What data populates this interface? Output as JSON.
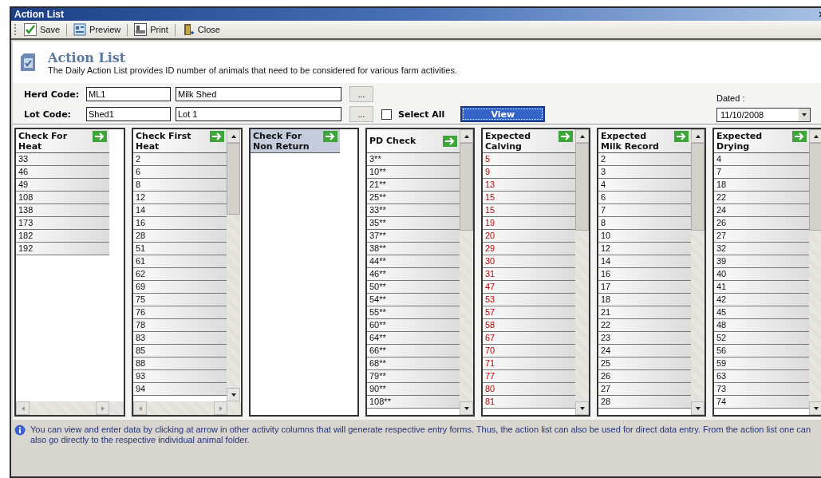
{
  "window": {
    "title": "Action List"
  },
  "toolbar": [
    {
      "kind": "save",
      "label": "Save"
    },
    {
      "kind": "preview",
      "label": "Preview"
    },
    {
      "kind": "print",
      "label": "Print"
    },
    {
      "kind": "close",
      "label": "Close"
    }
  ],
  "header": {
    "title": "Action List",
    "description": "The Daily Action List provides ID number of animals that need to be considered for various farm activities."
  },
  "form": {
    "herd": {
      "label": "Herd Code:",
      "code": "ML1",
      "name": "Milk Shed",
      "browse": "..."
    },
    "lot": {
      "label": "Lot Code:",
      "code": "Shed1",
      "name": "Lot 1",
      "browse": "..."
    },
    "select_all": {
      "label": "Select All",
      "checked": false
    },
    "view_button": "View",
    "dated": {
      "label": "Dated :",
      "value": "11/10/2008"
    }
  },
  "columns": [
    {
      "title": "Check For Heat",
      "selected": false,
      "kind": "plain",
      "vscroll": false,
      "hscroll": true,
      "rows": [
        "33",
        "46",
        "49",
        "108",
        "138",
        "173",
        "182",
        "192"
      ]
    },
    {
      "title": "Check First Heat",
      "selected": false,
      "kind": "plain",
      "vscroll": true,
      "hscroll": true,
      "rows": [
        "2",
        "6",
        "8",
        "12",
        "14",
        "16",
        "28",
        "51",
        "61",
        "62",
        "69",
        "75",
        "76",
        "78",
        "83",
        "85",
        "88",
        "93",
        "94"
      ]
    },
    {
      "title": "Check For Non Return",
      "selected": true,
      "vscroll": false,
      "hscroll": false
    },
    {
      "title": "PD Check",
      "selected": false,
      "kind": "plain",
      "vscroll": true,
      "hscroll": false,
      "rows": [
        "3**",
        "10**",
        "21**",
        "25**",
        "33**",
        "35**",
        "37**",
        "38**",
        "44**",
        "46**",
        "50**",
        "54**",
        "55**",
        "60**",
        "64**",
        "66**",
        "68**",
        "79**",
        "90**",
        "108**"
      ]
    },
    {
      "title": "Expected Calving",
      "selected": false,
      "kind": "alert",
      "vscroll": true,
      "hscroll": false,
      "rows": [
        "5",
        "9",
        "13",
        "15",
        "15",
        "19",
        "20",
        "29",
        "30",
        "31",
        "47",
        "53",
        "57",
        "58",
        "67",
        "70",
        "71",
        "77",
        "80",
        "81"
      ]
    },
    {
      "title": "Expected Milk Record",
      "selected": false,
      "kind": "plain",
      "vscroll": true,
      "hscroll": false,
      "rows": [
        "2",
        "3",
        "4",
        "6",
        "7",
        "8",
        "10",
        "12",
        "14",
        "16",
        "17",
        "18",
        "21",
        "22",
        "23",
        "24",
        "25",
        "26",
        "27",
        "28"
      ]
    },
    {
      "title": "Expected Drying",
      "selected": false,
      "kind": "plain",
      "vscroll": true,
      "hscroll": false,
      "rows": [
        "4",
        "7",
        "18",
        "22",
        "24",
        "26",
        "27",
        "32",
        "39",
        "40",
        "41",
        "42",
        "45",
        "48",
        "52",
        "56",
        "59",
        "63",
        "73",
        "74"
      ]
    }
  ],
  "note": "You can view and enter data  by clicking at arrow in other activity columns that will generate respective entry forms.  Thus, the action list can also be used for direct data entry.  From the action list one can also go directly to the respective individual animal folder."
}
